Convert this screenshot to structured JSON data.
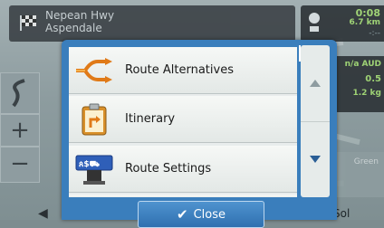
{
  "top_bar": {
    "street": "Nepean Hwy",
    "street_sub": "Aspendale"
  },
  "right_panel": {
    "time": "0:08",
    "distance": "6.7 km",
    "distance_sub": "-:--"
  },
  "right_panel2": {
    "value1": "n/a AUD",
    "value2": "0.5",
    "value3": "1.2 kg"
  },
  "right_panel3": {
    "label": "Green"
  },
  "map_controls": {
    "zoom_in": "+",
    "zoom_out": "−"
  },
  "bottom_right": {
    "text": "Sol"
  },
  "menu": {
    "items": [
      {
        "label": "Route Alternatives",
        "icon": "route-alternatives-icon"
      },
      {
        "label": "Itinerary",
        "icon": "itinerary-icon"
      },
      {
        "label": "Route Settings",
        "icon": "route-settings-icon"
      }
    ],
    "close_label": "Close"
  },
  "colors": {
    "panel_bg": "#3a7ebc",
    "item_bg": "#eef2f0",
    "text_accent": "#a0d870"
  }
}
